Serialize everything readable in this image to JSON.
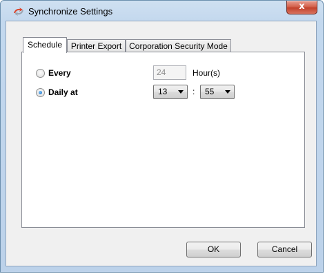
{
  "window": {
    "title": "Synchronize Settings",
    "close_label": "x",
    "title_icon": "sync-arrows-icon"
  },
  "tabs": [
    {
      "label": "Schedule",
      "active": true
    },
    {
      "label": "Printer Export",
      "active": false
    },
    {
      "label": "Corporation Security Mode",
      "active": false
    }
  ],
  "schedule": {
    "every": {
      "label": "Every",
      "selected": false,
      "value": "24",
      "unit": "Hour(s)"
    },
    "daily": {
      "label": "Daily at",
      "selected": true,
      "hour": "13",
      "separator": ":",
      "minute": "55"
    }
  },
  "buttons": {
    "ok": "OK",
    "cancel": "Cancel"
  }
}
